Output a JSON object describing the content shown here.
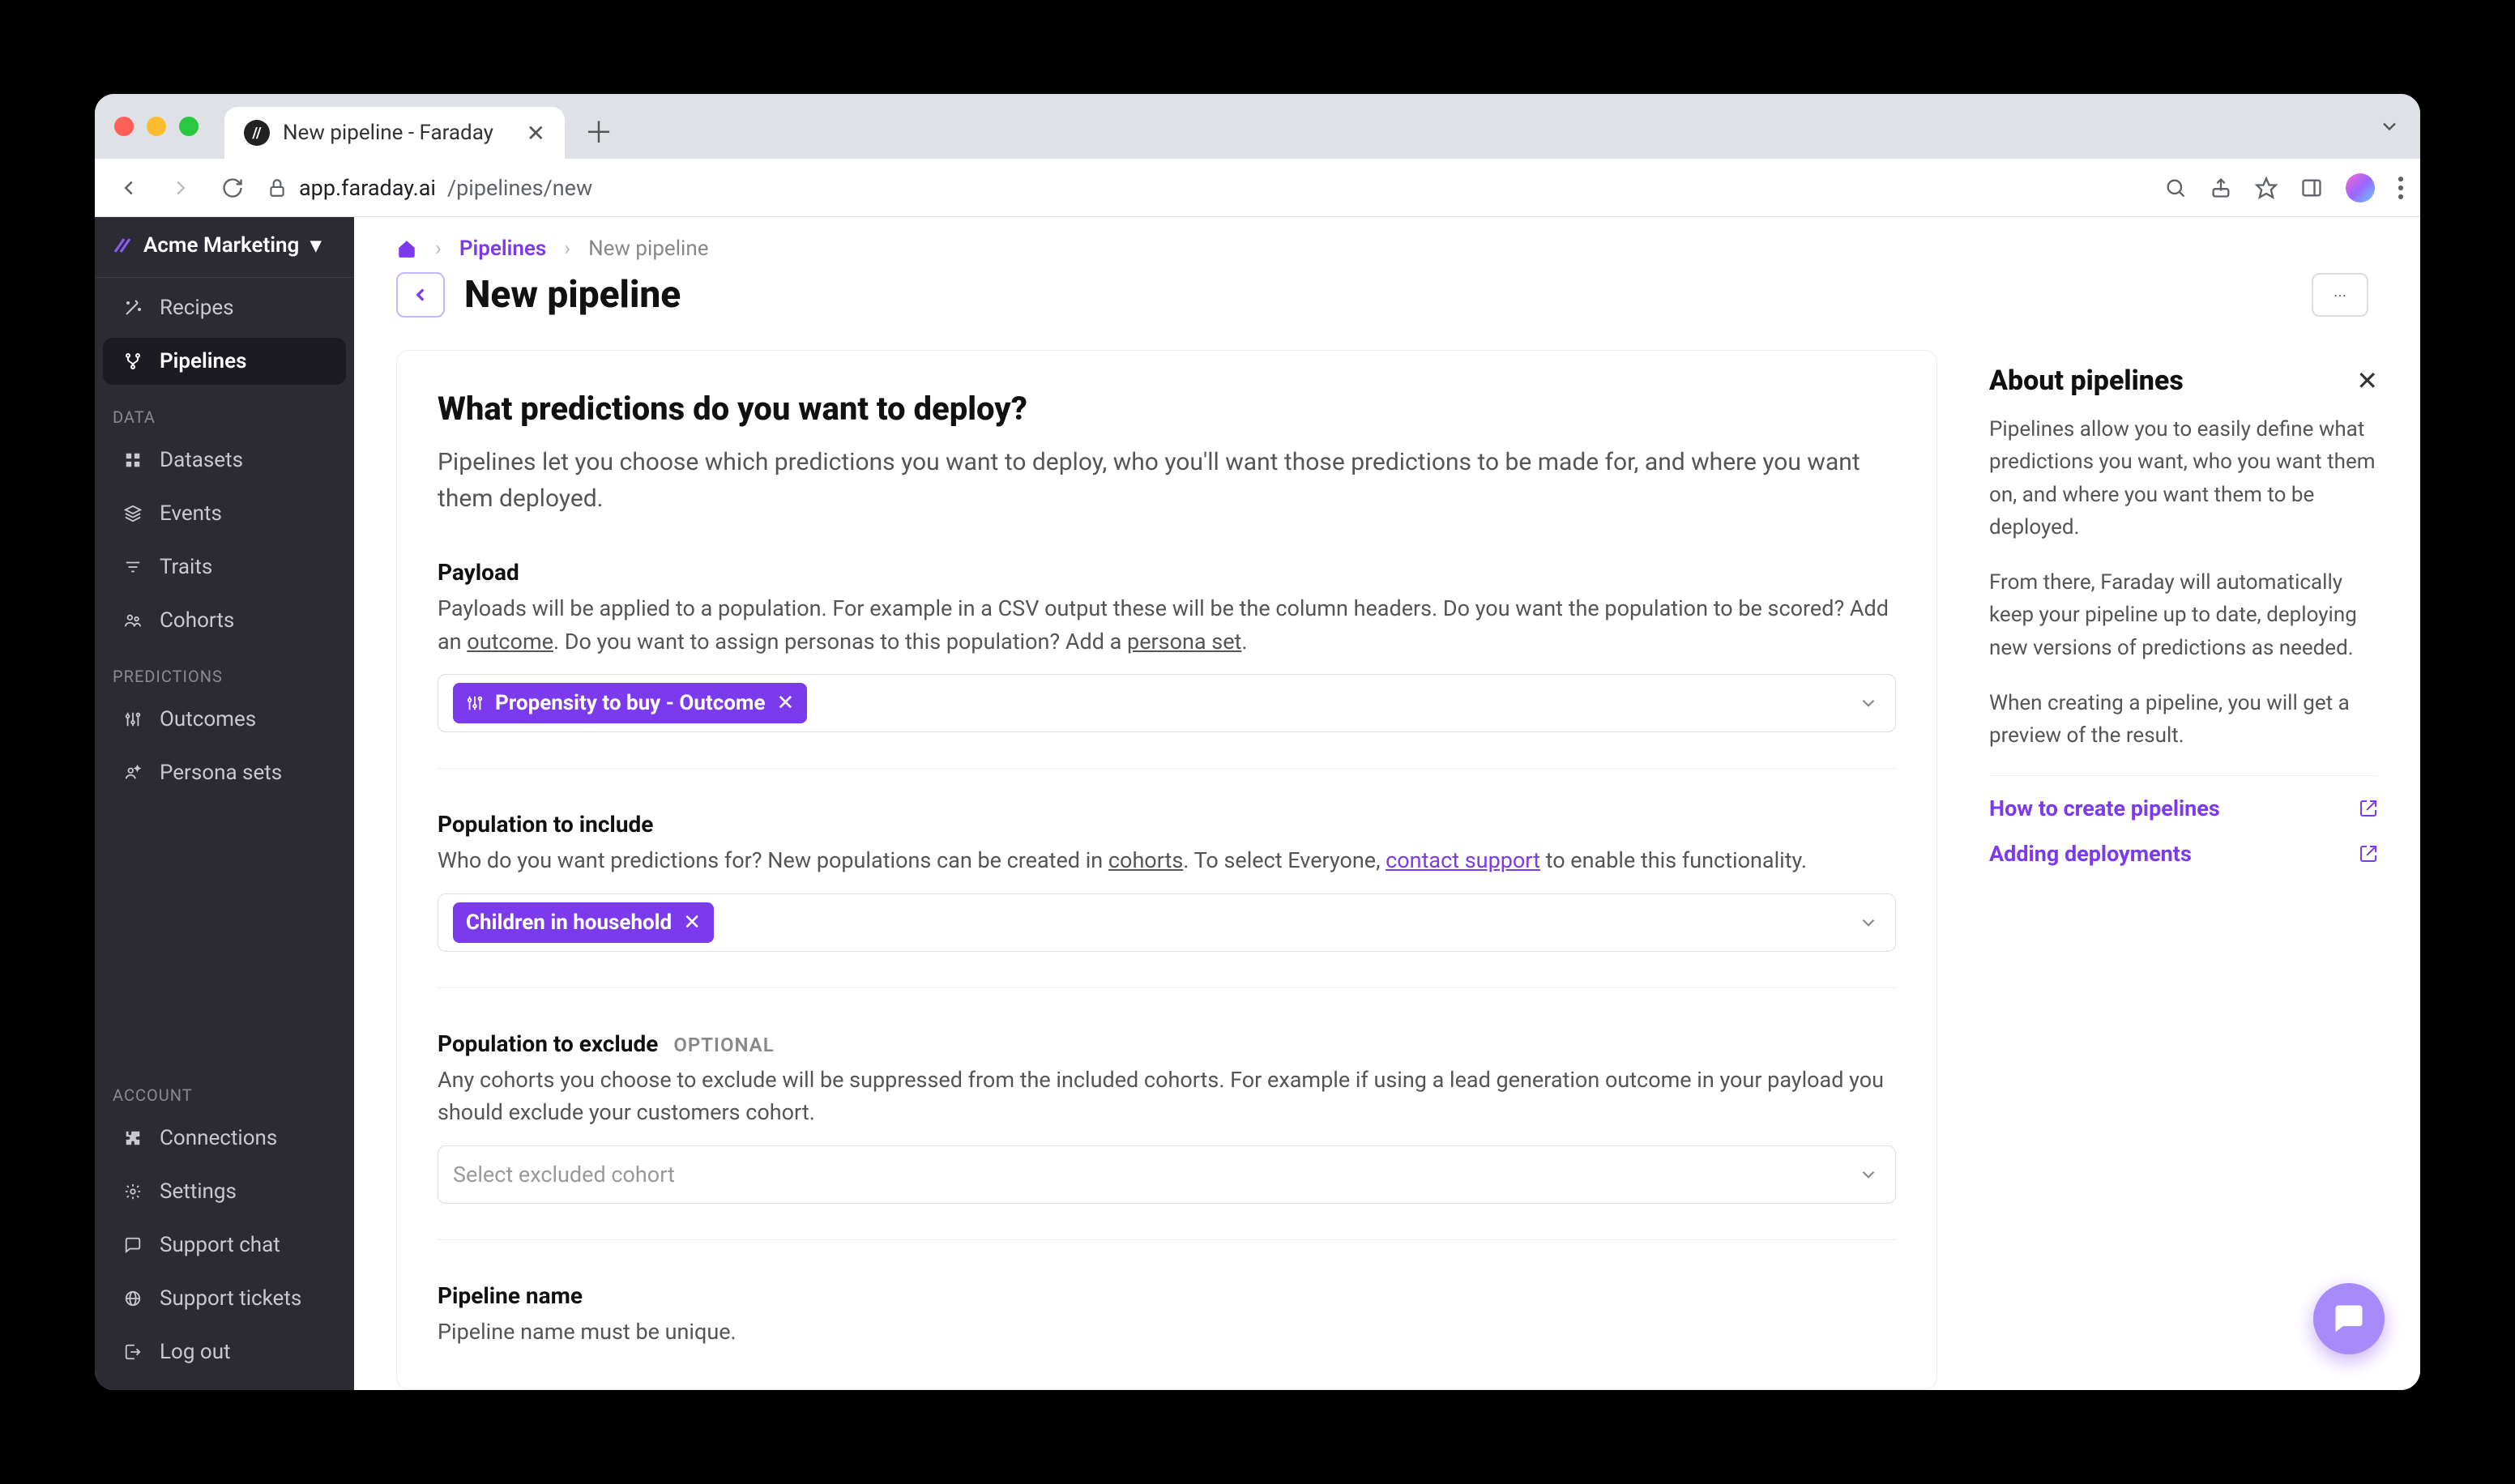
{
  "browser": {
    "tab_title": "New pipeline - Faraday",
    "url_host": "app.faraday.ai",
    "url_path": "/pipelines/new"
  },
  "sidebar": {
    "org_name": "Acme Marketing",
    "items_top": [
      {
        "label": "Recipes",
        "icon": "wand-icon"
      },
      {
        "label": "Pipelines",
        "icon": "fork-icon",
        "active": true
      }
    ],
    "section_data": "DATA",
    "items_data": [
      {
        "label": "Datasets",
        "icon": "grid-icon"
      },
      {
        "label": "Events",
        "icon": "layers-icon"
      },
      {
        "label": "Traits",
        "icon": "filter-icon"
      },
      {
        "label": "Cohorts",
        "icon": "people-icon"
      }
    ],
    "section_predictions": "PREDICTIONS",
    "items_pred": [
      {
        "label": "Outcomes",
        "icon": "sliders-icon"
      },
      {
        "label": "Persona sets",
        "icon": "sparkle-people-icon"
      }
    ],
    "section_account": "ACCOUNT",
    "items_account": [
      {
        "label": "Connections",
        "icon": "puzzle-icon"
      },
      {
        "label": "Settings",
        "icon": "gear-icon"
      },
      {
        "label": "Support chat",
        "icon": "chat-icon"
      },
      {
        "label": "Support tickets",
        "icon": "globe-icon"
      },
      {
        "label": "Log out",
        "icon": "logout-icon"
      }
    ]
  },
  "breadcrumbs": {
    "pipelines": "Pipelines",
    "current": "New pipeline"
  },
  "page": {
    "title": "New pipeline"
  },
  "form": {
    "heading": "What predictions do you want to deploy?",
    "intro": "Pipelines let you choose which predictions you want to deploy, who you'll want those predictions to be made for, and where you want them deployed.",
    "payload_label": "Payload",
    "payload_help_1": "Payloads will be applied to a population. For example in a CSV output these will be the column headers. Do you want the population to be scored? Add an ",
    "payload_help_outcome": "outcome",
    "payload_help_2": ". Do you want to assign personas to this population? Add a ",
    "payload_help_persona": "persona set",
    "payload_help_3": ".",
    "payload_chip": "Propensity to buy - Outcome",
    "include_label": "Population to include",
    "include_help_1": "Who do you want predictions for? New populations can be created in ",
    "include_help_cohorts": "cohorts",
    "include_help_2": ". To select Everyone, ",
    "include_help_contact": "contact support",
    "include_help_3": " to enable this functionality.",
    "include_chip": "Children in household",
    "exclude_label": "Population to exclude",
    "exclude_optional": "OPTIONAL",
    "exclude_help": "Any cohorts you choose to exclude will be suppressed from the included cohorts. For example if using a lead generation outcome in your payload you should exclude your customers cohort.",
    "exclude_placeholder": "Select excluded cohort",
    "name_label": "Pipeline name",
    "name_help": "Pipeline name must be unique."
  },
  "aside": {
    "title": "About pipelines",
    "p1": "Pipelines allow you to easily define what predictions you want, who you want them on, and where you want them to be deployed.",
    "p2": "From there, Faraday will automatically keep your pipeline up to date, deploying new versions of predictions as needed.",
    "p3": "When creating a pipeline, you will get a preview of the result.",
    "link1": "How to create pipelines",
    "link2": "Adding deployments"
  }
}
